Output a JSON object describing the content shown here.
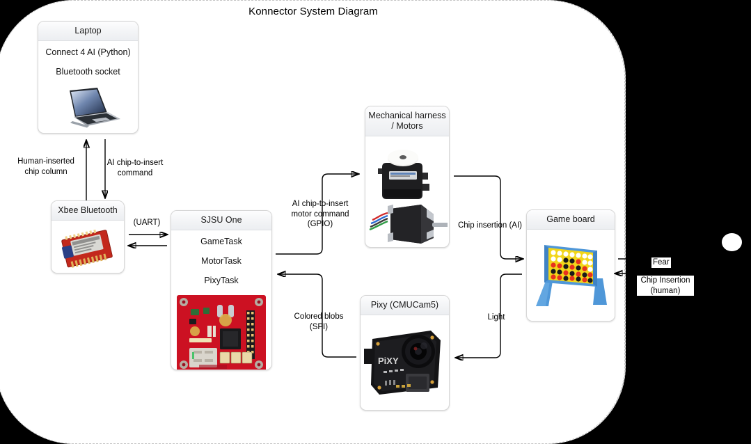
{
  "title": "Konnector System Diagram",
  "colors": {
    "background": "#000000",
    "surface": "#ffffff",
    "node_border": "#d6d6d6",
    "header_gradient_top": "#fdfdfe",
    "header_gradient_bottom": "#eceef1",
    "wire": "#000000",
    "pcb_red": "#cc1122",
    "pcb_black": "#141414",
    "board_yellow": "#f2d61a",
    "board_blue": "#4f97d8",
    "chip_red": "#e8321e",
    "chip_black": "#1a1a1a"
  },
  "nodes": {
    "laptop": {
      "header": "Laptop",
      "lines": [
        "Connect 4 AI (Python)",
        "Bluetooth socket"
      ],
      "image": "laptop-photo"
    },
    "xbee": {
      "header": "Xbee Bluetooth",
      "lines": [],
      "image": "xbee-module-photo"
    },
    "sjsu": {
      "header": "SJSU One",
      "lines": [
        "GameTask",
        "MotorTask",
        "PixyTask"
      ],
      "image": "sjsu-one-board-photo"
    },
    "motors": {
      "header": "Mechanical harness / Motors",
      "lines": [],
      "image": "servo-and-stepper-motor-photo"
    },
    "pixy": {
      "header": "Pixy (CMUCam5)",
      "lines": [],
      "image": "pixy-camera-photo"
    },
    "gameboard": {
      "header": "Game board",
      "lines": [],
      "image": "connect-four-board-photo"
    }
  },
  "edges": [
    {
      "id": "human-chip-column",
      "label": "Human-inserted\nchip column",
      "from": "xbee",
      "to": "laptop"
    },
    {
      "id": "ai-chip-command",
      "label": "AI chip-to-insert\ncommand",
      "from": "laptop",
      "to": "xbee"
    },
    {
      "id": "uart",
      "label": "(UART)",
      "from": "xbee",
      "to": "sjsu"
    },
    {
      "id": "motor-command",
      "label": "AI chip-to-insert\nmotor command\n(GPIO)",
      "from": "sjsu",
      "to": "motors"
    },
    {
      "id": "chip-insertion-ai",
      "label": "Chip insertion (AI)",
      "from": "motors",
      "to": "gameboard"
    },
    {
      "id": "colored-blobs",
      "label": "Colored blobs\n(SPI)",
      "from": "pixy",
      "to": "sjsu"
    },
    {
      "id": "light",
      "label": "Light",
      "from": "gameboard",
      "to": "pixy"
    },
    {
      "id": "fear",
      "label": "Fear",
      "from": "gameboard",
      "to": "human"
    },
    {
      "id": "chip-insertion-human",
      "label": "Chip Insertion\n(human)",
      "from": "human",
      "to": "gameboard"
    }
  ]
}
